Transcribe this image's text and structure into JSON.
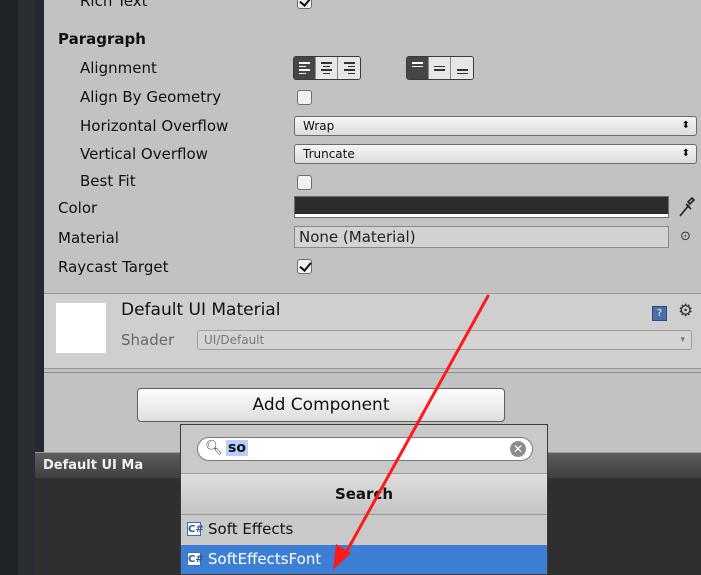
{
  "inspector": {
    "rich_text_label": "Rich Text",
    "paragraph_header": "Paragraph",
    "alignment_label": "Alignment",
    "align_by_geometry_label": "Align By Geometry",
    "horizontal_overflow": {
      "label": "Horizontal Overflow",
      "value": "Wrap"
    },
    "vertical_overflow": {
      "label": "Vertical Overflow",
      "value": "Truncate"
    },
    "best_fit_label": "Best Fit",
    "color_label": "Color",
    "material": {
      "label": "Material",
      "value": "None (Material)"
    },
    "raycast_target_label": "Raycast Target",
    "checkboxes": {
      "rich_text": true,
      "align_by_geometry": false,
      "best_fit": false,
      "raycast_target": true
    },
    "color_swatch": "#2d2d2d"
  },
  "material_panel": {
    "name": "Default UI Material",
    "shader_label": "Shader",
    "shader_value": "UI/Default"
  },
  "add_component_label": "Add Component",
  "dark_panel_title": "Default UI Ma",
  "popup": {
    "search_value": "so",
    "header": "Search",
    "items": [
      {
        "label": "Soft Effects",
        "selected": false
      },
      {
        "label": "SoftEffectsFont",
        "selected": true
      }
    ]
  },
  "annotation": {
    "color": "#ff1a1a"
  }
}
